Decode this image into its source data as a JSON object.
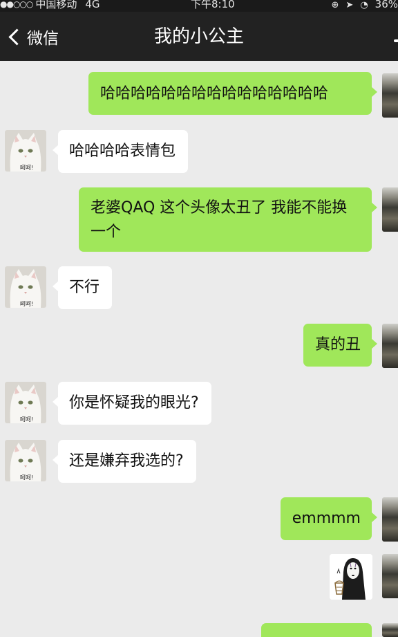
{
  "status_bar": {
    "signal_dots": "●●○○○",
    "carrier": "中国移动",
    "network": "4G",
    "time": "下午8:10",
    "battery": "36%"
  },
  "nav": {
    "back_label": "微信",
    "title": "我的小公主"
  },
  "contact_avatar_caption": "呵呵!",
  "messages": [
    {
      "from": "me",
      "text": "哈哈哈哈哈哈哈哈哈哈哈哈哈哈哈"
    },
    {
      "from": "other",
      "text": "哈哈哈哈表情包"
    },
    {
      "from": "me",
      "text": "老婆QAQ 这个头像太丑了 我能不能换一个"
    },
    {
      "from": "other",
      "text": "不行"
    },
    {
      "from": "me",
      "text": "真的丑"
    },
    {
      "from": "other",
      "text": "你是怀疑我的眼光?"
    },
    {
      "from": "other",
      "text": "还是嫌弃我选的?"
    },
    {
      "from": "me",
      "text": "emmmm"
    },
    {
      "from": "me",
      "sticker": "no-face-sticker"
    }
  ],
  "colors": {
    "chat_background": "#ebebeb",
    "outgoing_bubble": "#a0e75a",
    "incoming_bubble": "#ffffff",
    "nav_background": "#222222"
  }
}
